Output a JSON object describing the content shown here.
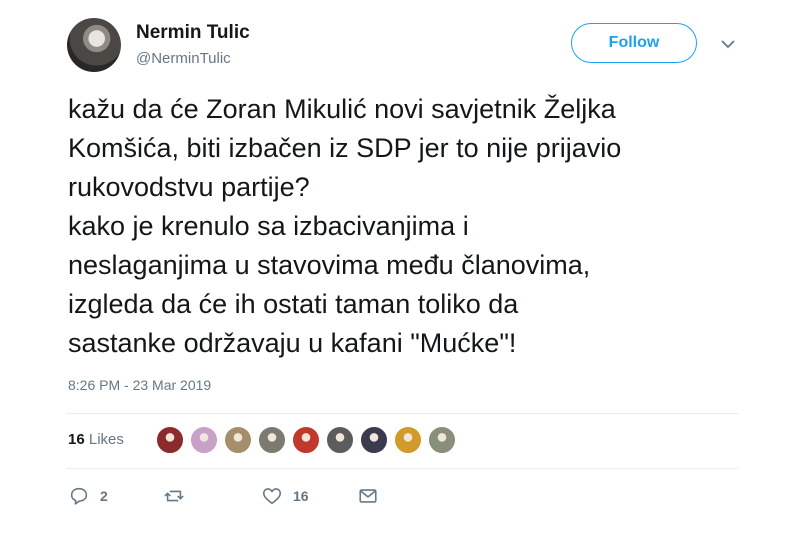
{
  "author": {
    "name": "Nermin Tulic",
    "handle": "@NerminTulic"
  },
  "follow_label": "Follow",
  "tweet_text": "kažu da će Zoran Mikulić novi savjetnik Željka\nKomšića, biti izbačen iz SDP jer to nije prijavio\nrukovodstvu partije?\nkako je krenulo sa izbacivanjima i\nneslaganjima u stavovima među članovima,\nizgleda da će ih ostati taman toliko da\nsastanke održavaju u kafani \"Mućke\"!",
  "timestamp": "8:26 PM - 23 Mar 2019",
  "likes": {
    "count": "16",
    "label": "Likes"
  },
  "likers": [
    {
      "color": "#8b2b2b"
    },
    {
      "color": "#c9a0c8"
    },
    {
      "color": "#a58f6a"
    },
    {
      "color": "#7d7a70"
    },
    {
      "color": "#c0392b"
    },
    {
      "color": "#5c5c5c"
    },
    {
      "color": "#3b3b4f"
    },
    {
      "color": "#d29a2b"
    },
    {
      "color": "#8a8f7a"
    }
  ],
  "actions": {
    "reply_count": "2",
    "retweet_count": "",
    "like_count": "16"
  },
  "colors": {
    "accent": "#1da1f2",
    "muted": "#657786",
    "text": "#14171a"
  },
  "icons": [
    "chevron-down-icon",
    "reply-icon",
    "retweet-icon",
    "heart-icon",
    "envelope-icon"
  ]
}
